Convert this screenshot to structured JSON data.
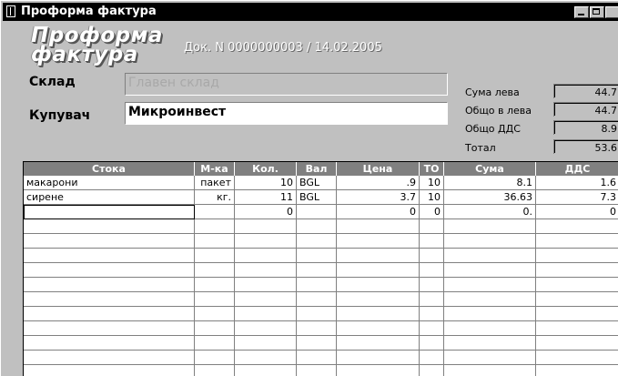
{
  "window": {
    "title": "Проформа фактура"
  },
  "logo": {
    "line1": "Проформа",
    "line2": "фактура"
  },
  "doc": {
    "number": "Док. N 0000000003 / 14.02.2005"
  },
  "fields": {
    "warehouse_label": "Склад",
    "warehouse_value": "Главен склад",
    "buyer_label": "Купувач",
    "buyer_value": "Микроинвест"
  },
  "summary": [
    {
      "label": "Сума лева",
      "value": "44.7"
    },
    {
      "label": "Общо в лева",
      "value": "44.7"
    },
    {
      "label": "Общо ДДС",
      "value": "8.9"
    },
    {
      "label": "Тотал",
      "value": "53.6"
    }
  ],
  "grid": {
    "columns": [
      "Стока",
      "М-ка",
      "Кол.",
      "Вал",
      "Цена",
      "ТО",
      "Сума",
      "ДДС"
    ],
    "rows": [
      [
        "макарони",
        "пакет",
        "10",
        "BGL",
        ".9",
        "10",
        "8.1",
        "1.6"
      ],
      [
        "сирене",
        "кг.",
        "11",
        "BGL",
        "3.7",
        "10",
        "36.63",
        "7.3"
      ],
      [
        "",
        "",
        "0",
        "",
        "0",
        "0",
        "0.",
        "0"
      ]
    ]
  }
}
